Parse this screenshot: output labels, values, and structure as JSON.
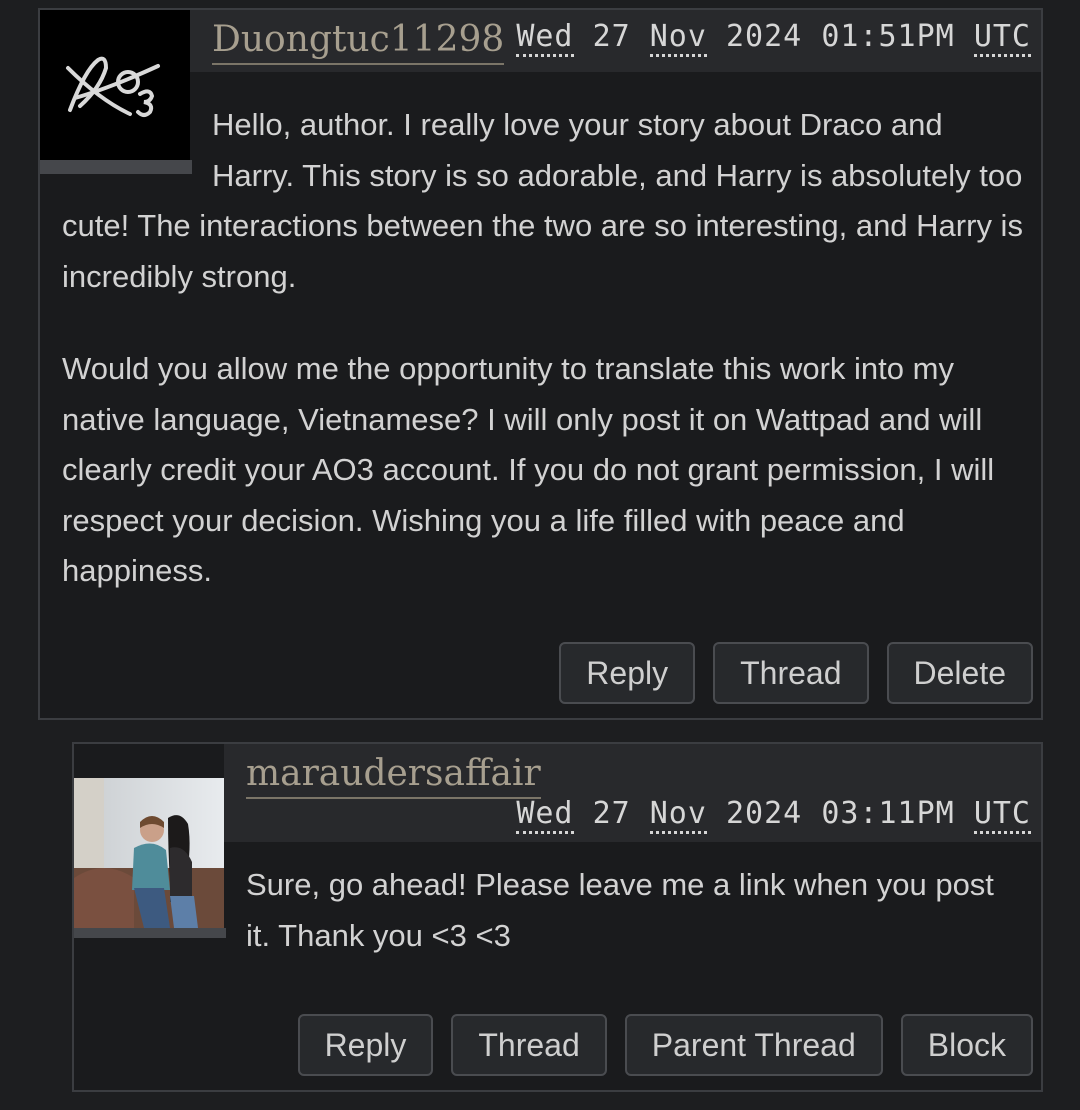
{
  "comments": [
    {
      "username": "Duongtuc11298",
      "date": {
        "weekday": "Wed",
        "day": "27",
        "month": "Nov",
        "year": "2024",
        "time": "01:51PM",
        "tz": "UTC"
      },
      "paragraphs": [
        "Hello, author. I really love your story about Draco and Harry. This story is so adorable, and Harry is absolutely too cute! The interactions between the two are so interesting, and Harry is incredibly strong.",
        "Would you allow me the opportunity to translate this work into my native language, Vietnamese? I will only post it on Wattpad and will clearly credit your AO3 account. If you do not grant permission, I will respect your decision. Wishing you a life filled with peace and happiness."
      ],
      "actions": [
        "Reply",
        "Thread",
        "Delete"
      ]
    },
    {
      "username": "maraudersaffair",
      "date": {
        "weekday": "Wed",
        "day": "27",
        "month": "Nov",
        "year": "2024",
        "time": "03:11PM",
        "tz": "UTC"
      },
      "paragraphs": [
        "Sure, go ahead! Please leave me a link when you post it. Thank you <3 <3"
      ],
      "actions": [
        "Reply",
        "Thread",
        "Parent Thread",
        "Block"
      ]
    }
  ],
  "colors": {
    "background": "#1d1e20",
    "header": "#28292c",
    "username": "#a79f8f",
    "button_border": "#4a4c50"
  }
}
